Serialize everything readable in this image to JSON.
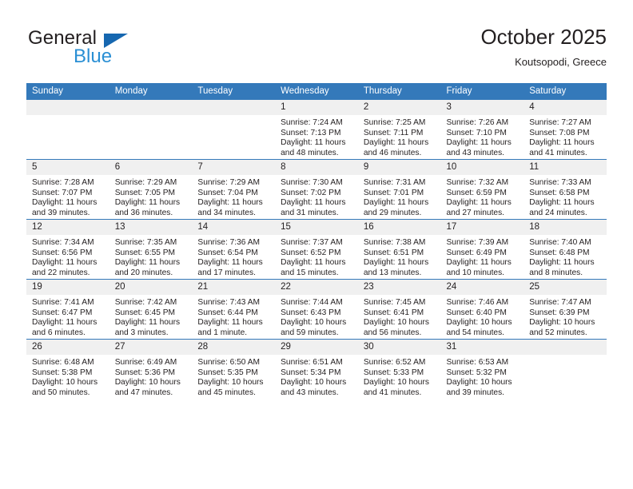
{
  "brand": {
    "name_top": "General",
    "name_bottom": "Blue",
    "logo_icon": "triangle-icon"
  },
  "header": {
    "title": "October 2025",
    "subtitle": "Koutsopodi, Greece"
  },
  "colors": {
    "header_blue": "#3479ba",
    "brand_blue": "#2a8fd4",
    "logo_triangle": "#1667b0",
    "daynum_bg": "#f0f0f0",
    "text": "#231f20"
  },
  "weekdays": [
    "Sunday",
    "Monday",
    "Tuesday",
    "Wednesday",
    "Thursday",
    "Friday",
    "Saturday"
  ],
  "labels": {
    "sunrise_prefix": "Sunrise:",
    "sunset_prefix": "Sunset:",
    "daylight_prefix": "Daylight:"
  },
  "weeks": [
    [
      {
        "day": "",
        "empty": true
      },
      {
        "day": "",
        "empty": true
      },
      {
        "day": "",
        "empty": true
      },
      {
        "day": "1",
        "sunrise": "Sunrise: 7:24 AM",
        "sunset": "Sunset: 7:13 PM",
        "daylight_1": "Daylight: 11 hours",
        "daylight_2": "and 48 minutes."
      },
      {
        "day": "2",
        "sunrise": "Sunrise: 7:25 AM",
        "sunset": "Sunset: 7:11 PM",
        "daylight_1": "Daylight: 11 hours",
        "daylight_2": "and 46 minutes."
      },
      {
        "day": "3",
        "sunrise": "Sunrise: 7:26 AM",
        "sunset": "Sunset: 7:10 PM",
        "daylight_1": "Daylight: 11 hours",
        "daylight_2": "and 43 minutes."
      },
      {
        "day": "4",
        "sunrise": "Sunrise: 7:27 AM",
        "sunset": "Sunset: 7:08 PM",
        "daylight_1": "Daylight: 11 hours",
        "daylight_2": "and 41 minutes."
      }
    ],
    [
      {
        "day": "5",
        "sunrise": "Sunrise: 7:28 AM",
        "sunset": "Sunset: 7:07 PM",
        "daylight_1": "Daylight: 11 hours",
        "daylight_2": "and 39 minutes."
      },
      {
        "day": "6",
        "sunrise": "Sunrise: 7:29 AM",
        "sunset": "Sunset: 7:05 PM",
        "daylight_1": "Daylight: 11 hours",
        "daylight_2": "and 36 minutes."
      },
      {
        "day": "7",
        "sunrise": "Sunrise: 7:29 AM",
        "sunset": "Sunset: 7:04 PM",
        "daylight_1": "Daylight: 11 hours",
        "daylight_2": "and 34 minutes."
      },
      {
        "day": "8",
        "sunrise": "Sunrise: 7:30 AM",
        "sunset": "Sunset: 7:02 PM",
        "daylight_1": "Daylight: 11 hours",
        "daylight_2": "and 31 minutes."
      },
      {
        "day": "9",
        "sunrise": "Sunrise: 7:31 AM",
        "sunset": "Sunset: 7:01 PM",
        "daylight_1": "Daylight: 11 hours",
        "daylight_2": "and 29 minutes."
      },
      {
        "day": "10",
        "sunrise": "Sunrise: 7:32 AM",
        "sunset": "Sunset: 6:59 PM",
        "daylight_1": "Daylight: 11 hours",
        "daylight_2": "and 27 minutes."
      },
      {
        "day": "11",
        "sunrise": "Sunrise: 7:33 AM",
        "sunset": "Sunset: 6:58 PM",
        "daylight_1": "Daylight: 11 hours",
        "daylight_2": "and 24 minutes."
      }
    ],
    [
      {
        "day": "12",
        "sunrise": "Sunrise: 7:34 AM",
        "sunset": "Sunset: 6:56 PM",
        "daylight_1": "Daylight: 11 hours",
        "daylight_2": "and 22 minutes."
      },
      {
        "day": "13",
        "sunrise": "Sunrise: 7:35 AM",
        "sunset": "Sunset: 6:55 PM",
        "daylight_1": "Daylight: 11 hours",
        "daylight_2": "and 20 minutes."
      },
      {
        "day": "14",
        "sunrise": "Sunrise: 7:36 AM",
        "sunset": "Sunset: 6:54 PM",
        "daylight_1": "Daylight: 11 hours",
        "daylight_2": "and 17 minutes."
      },
      {
        "day": "15",
        "sunrise": "Sunrise: 7:37 AM",
        "sunset": "Sunset: 6:52 PM",
        "daylight_1": "Daylight: 11 hours",
        "daylight_2": "and 15 minutes."
      },
      {
        "day": "16",
        "sunrise": "Sunrise: 7:38 AM",
        "sunset": "Sunset: 6:51 PM",
        "daylight_1": "Daylight: 11 hours",
        "daylight_2": "and 13 minutes."
      },
      {
        "day": "17",
        "sunrise": "Sunrise: 7:39 AM",
        "sunset": "Sunset: 6:49 PM",
        "daylight_1": "Daylight: 11 hours",
        "daylight_2": "and 10 minutes."
      },
      {
        "day": "18",
        "sunrise": "Sunrise: 7:40 AM",
        "sunset": "Sunset: 6:48 PM",
        "daylight_1": "Daylight: 11 hours",
        "daylight_2": "and 8 minutes."
      }
    ],
    [
      {
        "day": "19",
        "sunrise": "Sunrise: 7:41 AM",
        "sunset": "Sunset: 6:47 PM",
        "daylight_1": "Daylight: 11 hours",
        "daylight_2": "and 6 minutes."
      },
      {
        "day": "20",
        "sunrise": "Sunrise: 7:42 AM",
        "sunset": "Sunset: 6:45 PM",
        "daylight_1": "Daylight: 11 hours",
        "daylight_2": "and 3 minutes."
      },
      {
        "day": "21",
        "sunrise": "Sunrise: 7:43 AM",
        "sunset": "Sunset: 6:44 PM",
        "daylight_1": "Daylight: 11 hours",
        "daylight_2": "and 1 minute."
      },
      {
        "day": "22",
        "sunrise": "Sunrise: 7:44 AM",
        "sunset": "Sunset: 6:43 PM",
        "daylight_1": "Daylight: 10 hours",
        "daylight_2": "and 59 minutes."
      },
      {
        "day": "23",
        "sunrise": "Sunrise: 7:45 AM",
        "sunset": "Sunset: 6:41 PM",
        "daylight_1": "Daylight: 10 hours",
        "daylight_2": "and 56 minutes."
      },
      {
        "day": "24",
        "sunrise": "Sunrise: 7:46 AM",
        "sunset": "Sunset: 6:40 PM",
        "daylight_1": "Daylight: 10 hours",
        "daylight_2": "and 54 minutes."
      },
      {
        "day": "25",
        "sunrise": "Sunrise: 7:47 AM",
        "sunset": "Sunset: 6:39 PM",
        "daylight_1": "Daylight: 10 hours",
        "daylight_2": "and 52 minutes."
      }
    ],
    [
      {
        "day": "26",
        "sunrise": "Sunrise: 6:48 AM",
        "sunset": "Sunset: 5:38 PM",
        "daylight_1": "Daylight: 10 hours",
        "daylight_2": "and 50 minutes."
      },
      {
        "day": "27",
        "sunrise": "Sunrise: 6:49 AM",
        "sunset": "Sunset: 5:36 PM",
        "daylight_1": "Daylight: 10 hours",
        "daylight_2": "and 47 minutes."
      },
      {
        "day": "28",
        "sunrise": "Sunrise: 6:50 AM",
        "sunset": "Sunset: 5:35 PM",
        "daylight_1": "Daylight: 10 hours",
        "daylight_2": "and 45 minutes."
      },
      {
        "day": "29",
        "sunrise": "Sunrise: 6:51 AM",
        "sunset": "Sunset: 5:34 PM",
        "daylight_1": "Daylight: 10 hours",
        "daylight_2": "and 43 minutes."
      },
      {
        "day": "30",
        "sunrise": "Sunrise: 6:52 AM",
        "sunset": "Sunset: 5:33 PM",
        "daylight_1": "Daylight: 10 hours",
        "daylight_2": "and 41 minutes."
      },
      {
        "day": "31",
        "sunrise": "Sunrise: 6:53 AM",
        "sunset": "Sunset: 5:32 PM",
        "daylight_1": "Daylight: 10 hours",
        "daylight_2": "and 39 minutes."
      },
      {
        "day": "",
        "empty": true
      }
    ]
  ]
}
